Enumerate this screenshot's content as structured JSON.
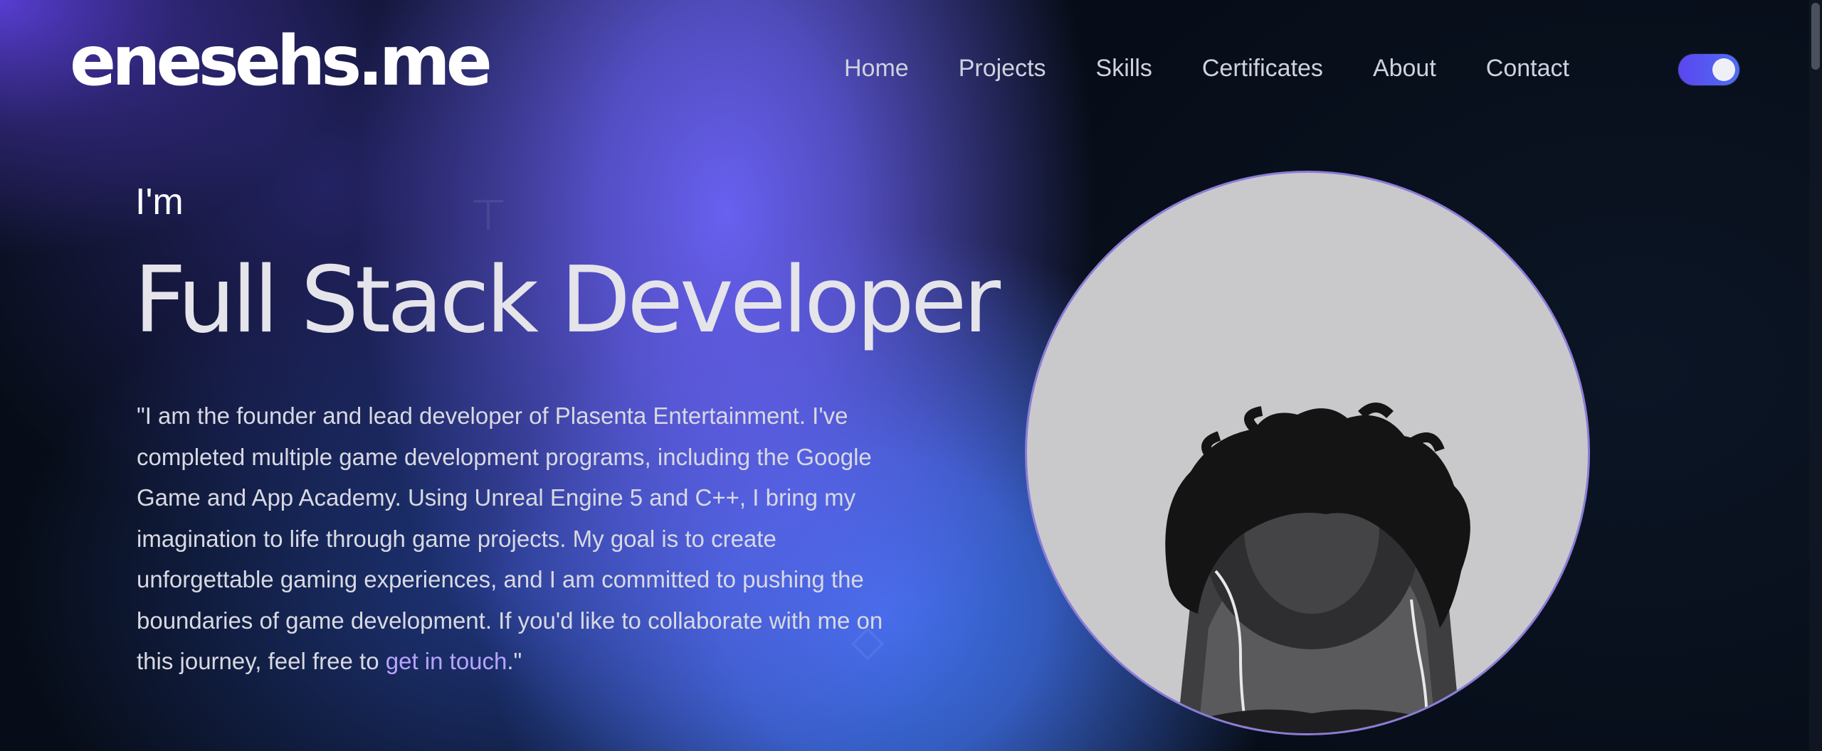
{
  "brand": {
    "logo_text": "enesehs.me"
  },
  "nav": {
    "items": [
      {
        "label": "Home"
      },
      {
        "label": "Projects"
      },
      {
        "label": "Skills"
      },
      {
        "label": "Certificates"
      },
      {
        "label": "About"
      },
      {
        "label": "Contact"
      }
    ],
    "theme_toggle_state": "on"
  },
  "hero": {
    "intro": "I'm",
    "headline": "Full Stack Developer",
    "bio_text": "\"I am the founder and lead developer of Plasenta Entertainment. I've completed multiple game development programs, including the Google Game and App Academy. Using Unreal Engine 5 and C++, I bring my imagination to life through game projects. My goal is to create unforgettable gaming experiences, and I am committed to pushing the boundaries of game development. If you'd like to collaborate with me on this journey, feel free to ",
    "bio_link_text": "get in touch",
    "bio_end": ".\""
  },
  "colors": {
    "background": "#070d18",
    "glow_purple": "#6a62f5",
    "glow_blue": "#3f6fe8",
    "link_accent": "#b7a3ff",
    "avatar_border": "#8b7dd8",
    "toggle_track": "#5b45f0"
  },
  "icons": {
    "theme_toggle": "toggle-switch-icon"
  }
}
